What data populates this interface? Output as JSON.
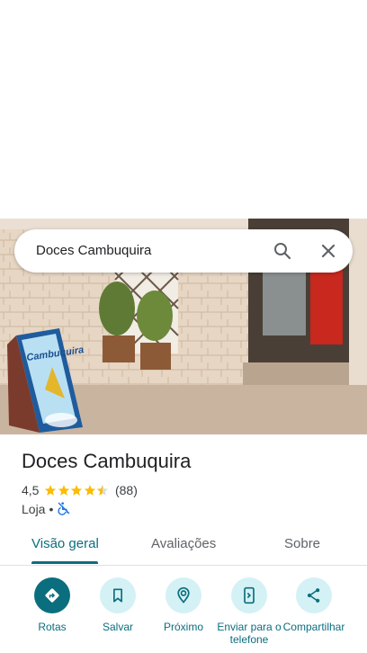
{
  "search": {
    "query": "Doces Cambuquira"
  },
  "place": {
    "name": "Doces Cambuquira",
    "rating": "4,5",
    "stars": 4.5,
    "review_count": "(88)",
    "category": "Loja",
    "separator": "•"
  },
  "tabs": [
    {
      "label": "Visão geral"
    },
    {
      "label": "Avaliações"
    },
    {
      "label": "Sobre"
    }
  ],
  "actions": [
    {
      "label": "Rotas",
      "icon": "directions-icon"
    },
    {
      "label": "Salvar",
      "icon": "bookmark-icon"
    },
    {
      "label": "Próximo",
      "icon": "nearby-icon"
    },
    {
      "label": "Enviar para o telefone",
      "icon": "send-to-phone-icon"
    },
    {
      "label": "Compartilhar",
      "icon": "share-icon"
    }
  ],
  "colors": {
    "accent": "#0b6e7e",
    "action_bg": "#d4f1f5",
    "star": "#fbbc04"
  },
  "photo": {
    "sign_text": "Cambuquira"
  }
}
